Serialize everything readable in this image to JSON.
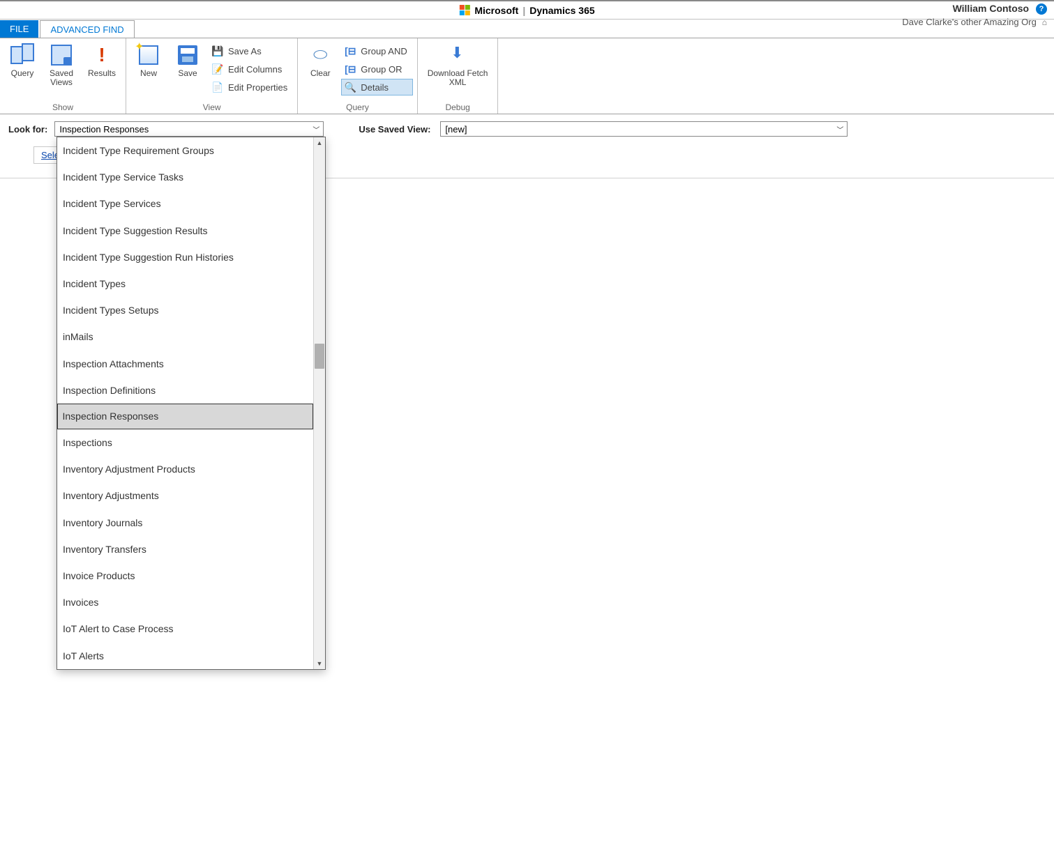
{
  "top": {
    "ms": "Microsoft",
    "product": "Dynamics 365",
    "user": "William Contoso",
    "org": "Dave Clarke's other Amazing Org"
  },
  "tabs": {
    "file": "FILE",
    "advanced": "ADVANCED FIND"
  },
  "ribbon": {
    "show": {
      "label": "Show",
      "query": "Query",
      "savedViews": "Saved\nViews",
      "results": "Results"
    },
    "view": {
      "label": "View",
      "new": "New",
      "save": "Save",
      "saveAs": "Save As",
      "editColumns": "Edit Columns",
      "editProperties": "Edit Properties"
    },
    "query": {
      "label": "Query",
      "clear": "Clear",
      "groupAnd": "Group AND",
      "groupOr": "Group OR",
      "details": "Details"
    },
    "debug": {
      "label": "Debug",
      "download": "Download Fetch\nXML"
    }
  },
  "filters": {
    "lookForLabel": "Look for:",
    "lookForValue": "Inspection Responses",
    "savedViewLabel": "Use Saved View:",
    "savedViewValue": "[new]",
    "selectLink": "Sele"
  },
  "dropdown": {
    "items": [
      "Incident Type Requirement Groups",
      "Incident Type Service Tasks",
      "Incident Type Services",
      "Incident Type Suggestion Results",
      "Incident Type Suggestion Run Histories",
      "Incident Types",
      "Incident Types Setups",
      "inMails",
      "Inspection Attachments",
      "Inspection Definitions",
      "Inspection Responses",
      "Inspections",
      "Inventory Adjustment Products",
      "Inventory Adjustments",
      "Inventory Journals",
      "Inventory Transfers",
      "Invoice Products",
      "Invoices",
      "IoT Alert to Case Process",
      "IoT Alerts"
    ],
    "selectedIndex": 10
  }
}
